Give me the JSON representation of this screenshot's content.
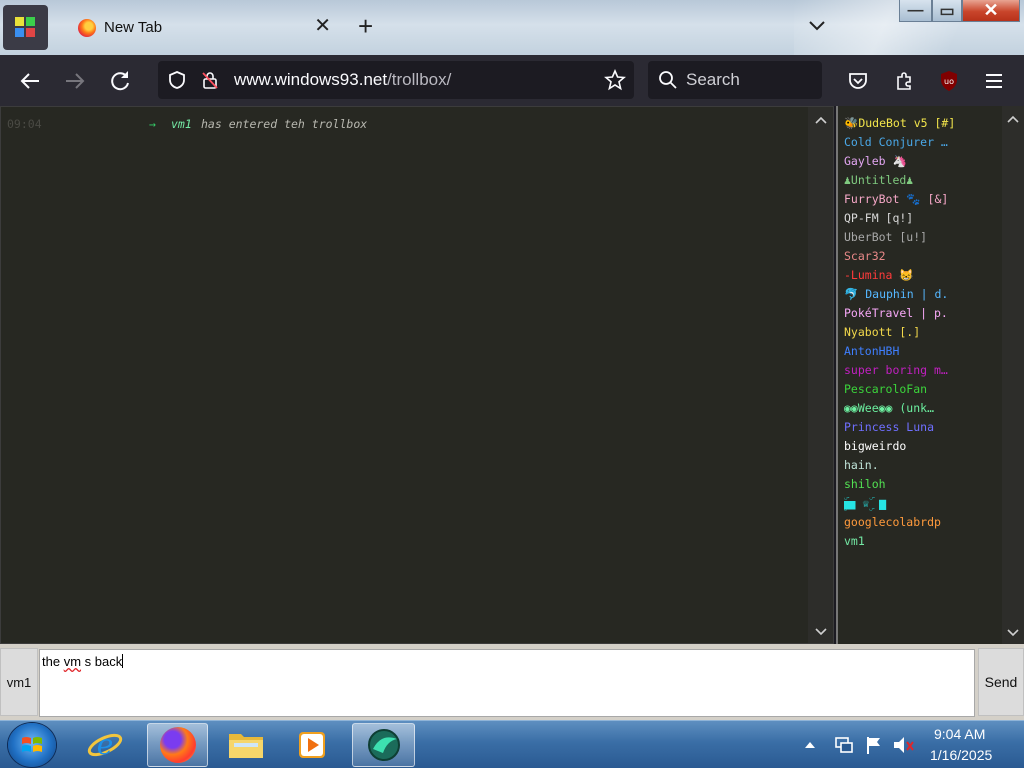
{
  "browser": {
    "tab_title": "New Tab",
    "url_host": "www.windows93.net",
    "url_path": "/trollbox/",
    "search_placeholder": "Search"
  },
  "chat": {
    "messages": [
      {
        "time": "09:04",
        "arrow": "→",
        "user": "vm1",
        "text": "has entered teh trollbox"
      }
    ]
  },
  "users": [
    {
      "name": "🐝DudeBot v5 [#]",
      "color": "#f2e54b"
    },
    {
      "name": "Cold Conjurer …",
      "color": "#4aa8e8"
    },
    {
      "name": "Gayleb 🦄",
      "color": "#e3a6f2"
    },
    {
      "name": "♟Untitled♟",
      "color": "#7fc97f"
    },
    {
      "name": "FurryBot 🐾 [&]",
      "color": "#f7a8c8"
    },
    {
      "name": "QP-FM [q!]",
      "color": "#d8d8d8"
    },
    {
      "name": "UberBot [u!]",
      "color": "#a8a8a8"
    },
    {
      "name": "Scar32",
      "color": "#e88888"
    },
    {
      "name": "-Lumina 😸",
      "color": "#ff3b3b"
    },
    {
      "name": "🐬 Dauphin | d.",
      "color": "#55b7ff"
    },
    {
      "name": "PokéTravel | p.",
      "color": "#f7a8f7"
    },
    {
      "name": "Nyabott [.]",
      "color": "#f2d84b"
    },
    {
      "name": "AntonHBH",
      "color": "#3f7fff"
    },
    {
      "name": "super boring m…",
      "color": "#c020c0"
    },
    {
      "name": "PescaroloFan",
      "color": "#3bd43b"
    },
    {
      "name": "◉◉Wee◉◉ (unk…",
      "color": "#6cf0a0"
    },
    {
      "name": "Princess Luna",
      "color": "#6f6fff"
    },
    {
      "name": "bigweirdo",
      "color": "#ffffff"
    },
    {
      "name": "hain.",
      "color": "#bfe3d8"
    },
    {
      "name": "shiloh",
      "color": "#52e052"
    },
    {
      "name": "▆ۣۜ ♕ ۣۜ ▆",
      "color": "#26e4e4"
    },
    {
      "name": "googlecolabrdp",
      "color": "#ff9a3c"
    },
    {
      "name": "vm1",
      "color": "#74e8a4"
    }
  ],
  "input": {
    "nick": "vm1",
    "text_before": "the ",
    "text_misspelled": "vm",
    "text_after": " s back",
    "send_label": "Send"
  },
  "taskbar": {
    "time": "9:04 AM",
    "date": "1/16/2025"
  }
}
